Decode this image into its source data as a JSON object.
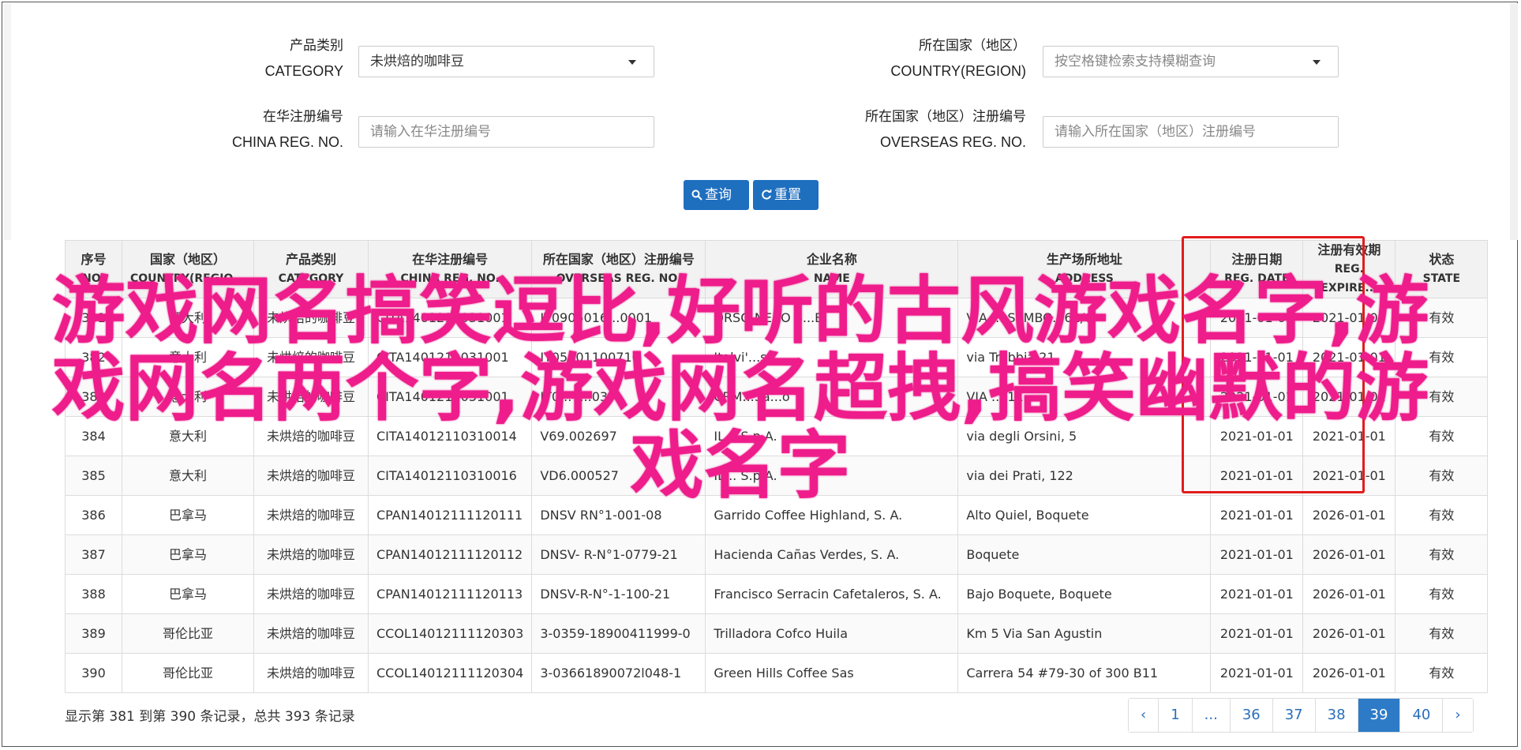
{
  "search": {
    "category": {
      "label_zh": "产品类别",
      "label_en": "CATEGORY",
      "value": "未烘焙的咖啡豆"
    },
    "country": {
      "label_zh": "所在国家（地区）",
      "label_en": "COUNTRY(REGION)",
      "placeholder": "按空格键检索支持模糊查询"
    },
    "china_reg": {
      "label_zh": "在华注册编号",
      "label_en": "CHINA REG. NO.",
      "placeholder": "请输入在华注册编号"
    },
    "overseas_reg": {
      "label_zh": "所在国家（地区）注册编号",
      "label_en": "OVERSEAS REG. NO.",
      "placeholder": "请输入所在国家（地区）注册编号"
    },
    "query_button": "查询",
    "reset_button": "重置"
  },
  "table": {
    "headers": [
      {
        "zh": "序号",
        "en": "NO."
      },
      {
        "zh": "国家（地区）",
        "en": "COUNTRY(REGIO..."
      },
      {
        "zh": "产品类别",
        "en": "CATEGORY"
      },
      {
        "zh": "在华注册编号",
        "en": "CHINA REG. NO."
      },
      {
        "zh": "所在国家（地区）注册编号",
        "en": "OVERSEAS REG. NO."
      },
      {
        "zh": "企业名称",
        "en": "NAME"
      },
      {
        "zh": "生产场所地址",
        "en": "ADDRESS"
      },
      {
        "zh": "注册日期",
        "en": "REG. DATE"
      },
      {
        "zh": "注册有效期",
        "en": "REG. EXPIRE..."
      },
      {
        "zh": "状态",
        "en": "STATE"
      }
    ],
    "rows": [
      [
        "381",
        "意大利",
        "未烘焙的咖啡豆",
        "CITA1401211031001",
        "IT0905016...0001",
        "ORSO NERO S...B",
        "VIA ... SEMBO...62/6",
        "2021-01-01",
        "2021-01-01",
        "有效"
      ],
      [
        "382",
        "意大利",
        "未烘焙的咖啡豆",
        "CITA1401211031001",
        "IT05901100710",
        "Italvi'...srl",
        "via Trebbia 21",
        "2021-01-01",
        "2021-01-01",
        "有效"
      ],
      [
        "383",
        "意大利",
        "未烘焙的咖啡豆",
        "CITA1401211031001",
        "IT0...7...03",
        "CRM...Sa...o",
        "VIA ... 11",
        "2021-01-01",
        "2021-01-01",
        "有效"
      ],
      [
        "384",
        "意大利",
        "未烘焙的咖啡豆",
        "CITA14012110310014",
        "V69.002697",
        "IL... S.p.A.",
        "via degli Orsini, 5",
        "2021-01-01",
        "2021-01-01",
        "有效"
      ],
      [
        "385",
        "意大利",
        "未烘焙的咖啡豆",
        "CITA14012110310016",
        "VD6.000527",
        "IL... S.p.A.",
        "via dei Prati, 122",
        "2021-01-01",
        "2021-01-01",
        "有效"
      ],
      [
        "386",
        "巴拿马",
        "未烘焙的咖啡豆",
        "CPAN14012111120111",
        "DNSV RN°1-001-08",
        "Garrido Coffee Highland, S. A.",
        "Alto Quiel, Boquete",
        "2021-01-01",
        "2026-01-01",
        "有效"
      ],
      [
        "387",
        "巴拿马",
        "未烘焙的咖啡豆",
        "CPAN14012111120112",
        "DNSV- R-N°1-0779-21",
        "Hacienda Cañas Verdes, S. A.",
        "Boquete",
        "2021-01-01",
        "2026-01-01",
        "有效"
      ],
      [
        "388",
        "巴拿马",
        "未烘焙的咖啡豆",
        "CPAN14012111120113",
        "DNSV-R-N°-1-100-21",
        "Francisco Serracin Cafetaleros, S. A.",
        "Bajo Boquete, Boquete",
        "2021-01-01",
        "2026-01-01",
        "有效"
      ],
      [
        "389",
        "哥伦比亚",
        "未烘焙的咖啡豆",
        "CCOL14012111120303",
        "3-0359-18900411999-0",
        "Trilladora Cofco Huila",
        "Km 5 Via San Agustin",
        "2021-01-01",
        "2026-01-01",
        "有效"
      ],
      [
        "390",
        "哥伦比亚",
        "未烘焙的咖啡豆",
        "CCOL14012111120304",
        "3-03661890072l048-1",
        "Green Hills Coffee Sas",
        "Carrera 54 #79-30 of 300 B11",
        "2021-01-01",
        "2026-01-01",
        "有效"
      ]
    ]
  },
  "overlay_text": "游戏网名搞笑逗比,好听的古风游戏名字,游戏网名两个字,游戏网名超拽,搞笑幽默的游戏名字",
  "footer": {
    "summary": "显示第 381 到第 390 条记录，总共 393 条记录",
    "pages": [
      "‹",
      "1",
      "...",
      "36",
      "37",
      "38",
      "39",
      "40",
      "›"
    ],
    "active_page": "39"
  },
  "colors": {
    "accent": "#1f6fbf",
    "highlight_box": "#e21c1c",
    "overlay": "#ee1d8b"
  }
}
